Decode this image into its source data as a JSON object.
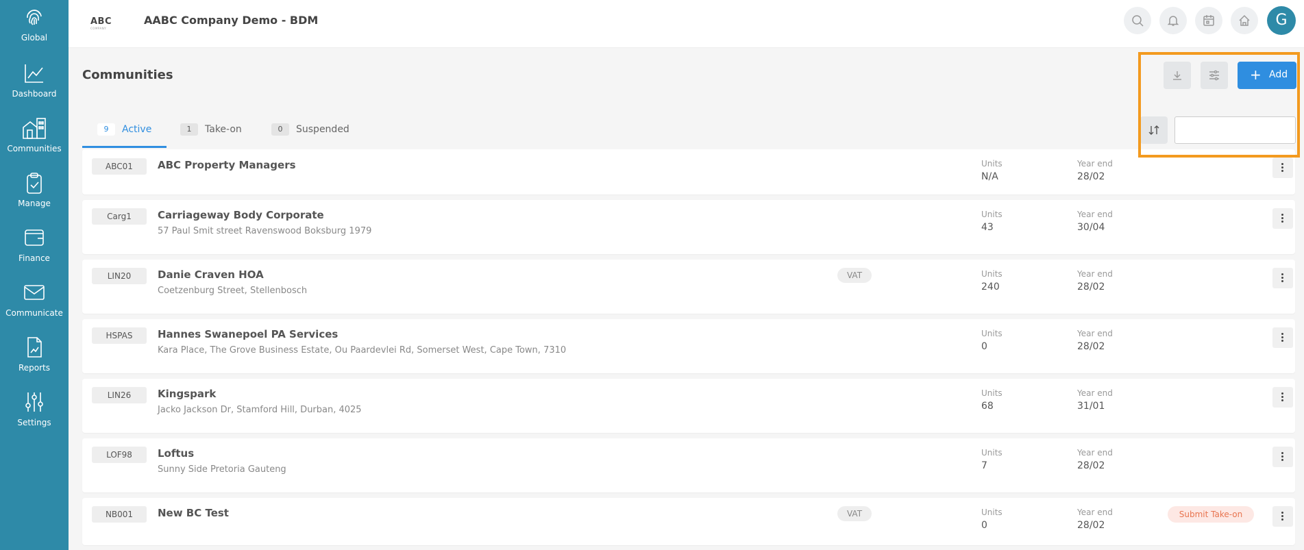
{
  "sidebar": {
    "items": [
      {
        "label": "Global",
        "icon": "fingerprint-icon"
      },
      {
        "label": "Dashboard",
        "icon": "chart-line-icon"
      },
      {
        "label": "Communities",
        "icon": "buildings-icon"
      },
      {
        "label": "Manage",
        "icon": "clipboard-check-icon"
      },
      {
        "label": "Finance",
        "icon": "wallet-icon"
      },
      {
        "label": "Communicate",
        "icon": "envelope-icon"
      },
      {
        "label": "Reports",
        "icon": "report-icon"
      },
      {
        "label": "Settings",
        "icon": "sliders-icon"
      }
    ]
  },
  "header": {
    "logo_text": "ABC",
    "logo_sub": "COMPANY",
    "company_name": "AABC Company Demo - BDM",
    "avatar_initial": "G"
  },
  "page": {
    "title": "Communities",
    "add_label": "Add"
  },
  "tabs": [
    {
      "count": "9",
      "label": "Active"
    },
    {
      "count": "1",
      "label": "Take-on"
    },
    {
      "count": "0",
      "label": "Suspended"
    }
  ],
  "search": {
    "value": "",
    "placeholder": ""
  },
  "columns": {
    "units": "Units",
    "year_end": "Year end"
  },
  "rows": [
    {
      "code": "ABC01",
      "name": "ABC Property Managers",
      "address": "",
      "vat": "",
      "units": "N/A",
      "year_end": "28/02",
      "badge": ""
    },
    {
      "code": "Carg1",
      "name": "Carriageway Body Corporate",
      "address": "57 Paul Smit street Ravenswood Boksburg 1979",
      "vat": "",
      "units": "43",
      "year_end": "30/04",
      "badge": ""
    },
    {
      "code": "LIN20",
      "name": "Danie Craven HOA",
      "address": "Coetzenburg Street, Stellenbosch",
      "vat": "VAT",
      "units": "240",
      "year_end": "28/02",
      "badge": ""
    },
    {
      "code": "HSPAS",
      "name": "Hannes Swanepoel PA Services",
      "address": "Kara Place, The Grove Business Estate, Ou Paardevlei Rd, Somerset West, Cape Town, 7310",
      "vat": "",
      "units": "0",
      "year_end": "28/02",
      "badge": ""
    },
    {
      "code": "LIN26",
      "name": "Kingspark",
      "address": "Jacko Jackson Dr, Stamford Hill, Durban, 4025",
      "vat": "",
      "units": "68",
      "year_end": "31/01",
      "badge": ""
    },
    {
      "code": "LOF98",
      "name": "Loftus",
      "address": "Sunny Side Pretoria Gauteng",
      "vat": "",
      "units": "7",
      "year_end": "28/02",
      "badge": ""
    },
    {
      "code": "NB001",
      "name": "New BC Test",
      "address": "",
      "vat": "VAT",
      "units": "0",
      "year_end": "28/02",
      "badge": "Submit Take-on"
    }
  ],
  "colors": {
    "sidebar": "#2e8aa8",
    "accent": "#2f8ee0",
    "highlight": "#f39a1f",
    "badge_text": "#e8744f"
  }
}
